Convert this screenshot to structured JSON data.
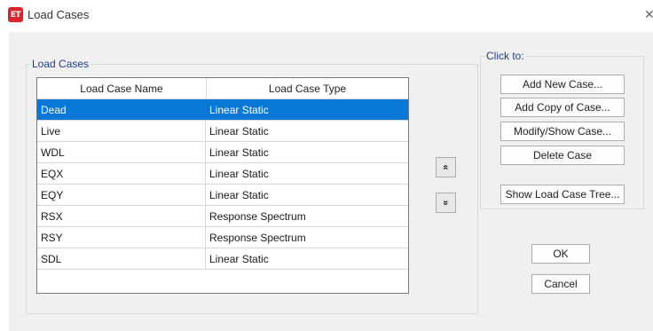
{
  "window": {
    "title": "Load Cases",
    "icon_text": "ET",
    "close_glyph": "✕"
  },
  "load_cases_group": {
    "label": "Load Cases"
  },
  "table": {
    "columns": [
      "Load Case Name",
      "Load Case Type"
    ],
    "rows": [
      {
        "name": "Dead",
        "type": "Linear Static",
        "selected": true
      },
      {
        "name": "Live",
        "type": "Linear Static"
      },
      {
        "name": "WDL",
        "type": "Linear Static"
      },
      {
        "name": "EQX",
        "type": "Linear Static"
      },
      {
        "name": "EQY",
        "type": "Linear Static"
      },
      {
        "name": "RSX",
        "type": "Response Spectrum"
      },
      {
        "name": "RSY",
        "type": "Response Spectrum"
      },
      {
        "name": "SDL",
        "type": "Linear Static"
      }
    ]
  },
  "move_buttons": {
    "up_glyph": "«",
    "down_glyph": "»"
  },
  "click_to_group": {
    "label": "Click to:",
    "add_new": "Add New Case...",
    "add_copy": "Add Copy of Case...",
    "modify_show": "Modify/Show Case...",
    "delete": "Delete Case",
    "show_tree": "Show Load Case Tree..."
  },
  "dialog_buttons": {
    "ok": "OK",
    "cancel": "Cancel"
  },
  "colors": {
    "selection": "#0a78d7",
    "group_label": "#1f3f8c",
    "app_icon": "#d9252b"
  }
}
